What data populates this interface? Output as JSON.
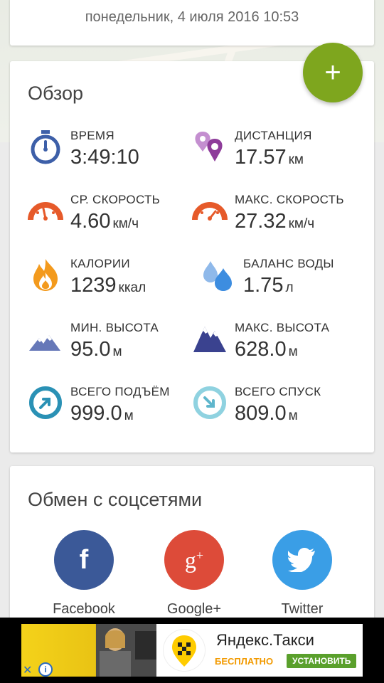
{
  "header": {
    "date": "понедельник, 4 июля 2016 10:53"
  },
  "fab": {
    "label": "+"
  },
  "overview": {
    "title": "Обзор",
    "stats": [
      {
        "label": "ВРЕМЯ",
        "value": "3:49:10",
        "unit": "",
        "icon": "stopwatch-icon"
      },
      {
        "label": "ДИСТАНЦИЯ",
        "value": "17.57",
        "unit": "км",
        "icon": "map-pins-icon"
      },
      {
        "label": "СР. СКОРОСТЬ",
        "value": "4.60",
        "unit": "км/ч",
        "icon": "speedometer-icon"
      },
      {
        "label": "МАКС. СКОРОСТЬ",
        "value": "27.32",
        "unit": "км/ч",
        "icon": "speedometer-max-icon"
      },
      {
        "label": "КАЛОРИИ",
        "value": "1239",
        "unit": "ккал",
        "icon": "flame-icon"
      },
      {
        "label": "БАЛАНС ВОДЫ",
        "value": "1.75",
        "unit": "л",
        "icon": "water-drops-icon"
      },
      {
        "label": "МИН. ВЫСОТА",
        "value": "95.0",
        "unit": "м",
        "icon": "mountain-low-icon"
      },
      {
        "label": "МАКС. ВЫСОТА",
        "value": "628.0",
        "unit": "м",
        "icon": "mountain-high-icon"
      },
      {
        "label": "ВСЕГО ПОДЪЁМ",
        "value": "999.0",
        "unit": "м",
        "icon": "ascent-icon"
      },
      {
        "label": "ВСЕГО СПУСК",
        "value": "809.0",
        "unit": "м",
        "icon": "descent-icon"
      }
    ]
  },
  "social": {
    "title": "Обмен с соцсетями",
    "items": [
      {
        "name": "Facebook",
        "icon": "facebook-icon",
        "color": "#3b5998"
      },
      {
        "name": "Google+",
        "icon": "google-plus-icon",
        "color": "#dd4b39"
      },
      {
        "name": "Twitter",
        "icon": "twitter-icon",
        "color": "#3a9ee6"
      }
    ]
  },
  "ad": {
    "title": "Яндекс.Такси",
    "free": "БЕСПЛАТНО",
    "install": "УСТАНОВИТЬ"
  },
  "colors": {
    "accent": "#7ea61e",
    "blue": "#3d5fa8",
    "purple": "#8e3c9a",
    "orange": "#e65a2a",
    "fire": "#f39a1d",
    "water": "#3d8de0",
    "mountain": "#6678b8",
    "teal": "#2a91b5"
  }
}
